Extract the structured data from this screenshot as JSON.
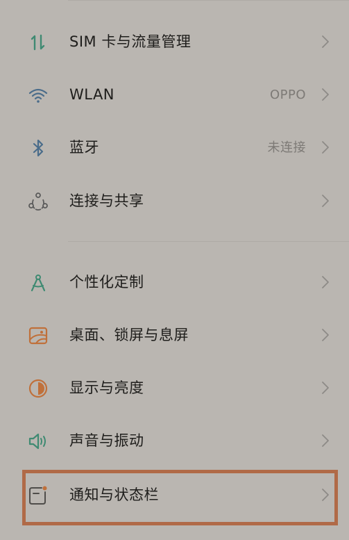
{
  "settings": {
    "items": [
      {
        "label": "SIM 卡与流量管理",
        "value": "",
        "icon": "sim-data-arrows-icon"
      },
      {
        "label": "WLAN",
        "value": "OPPO",
        "icon": "wifi-icon"
      },
      {
        "label": "蓝牙",
        "value": "未连接",
        "icon": "bluetooth-icon"
      },
      {
        "label": "连接与共享",
        "value": "",
        "icon": "connection-sharing-icon"
      },
      {
        "label": "个性化定制",
        "value": "",
        "icon": "personalization-compass-icon"
      },
      {
        "label": "桌面、锁屏与息屏",
        "value": "",
        "icon": "wallpaper-icon"
      },
      {
        "label": "显示与亮度",
        "value": "",
        "icon": "brightness-icon"
      },
      {
        "label": "声音与振动",
        "value": "",
        "icon": "speaker-vibration-icon"
      },
      {
        "label": "通知与状态栏",
        "value": "",
        "icon": "notification-statusbar-icon"
      }
    ]
  },
  "colors": {
    "background": "#bab6b1",
    "highlight_border": "#b06a47",
    "teal_accent": "#3f8a72",
    "blue_accent": "#4a6c8a",
    "orange_accent": "#c0703a"
  }
}
